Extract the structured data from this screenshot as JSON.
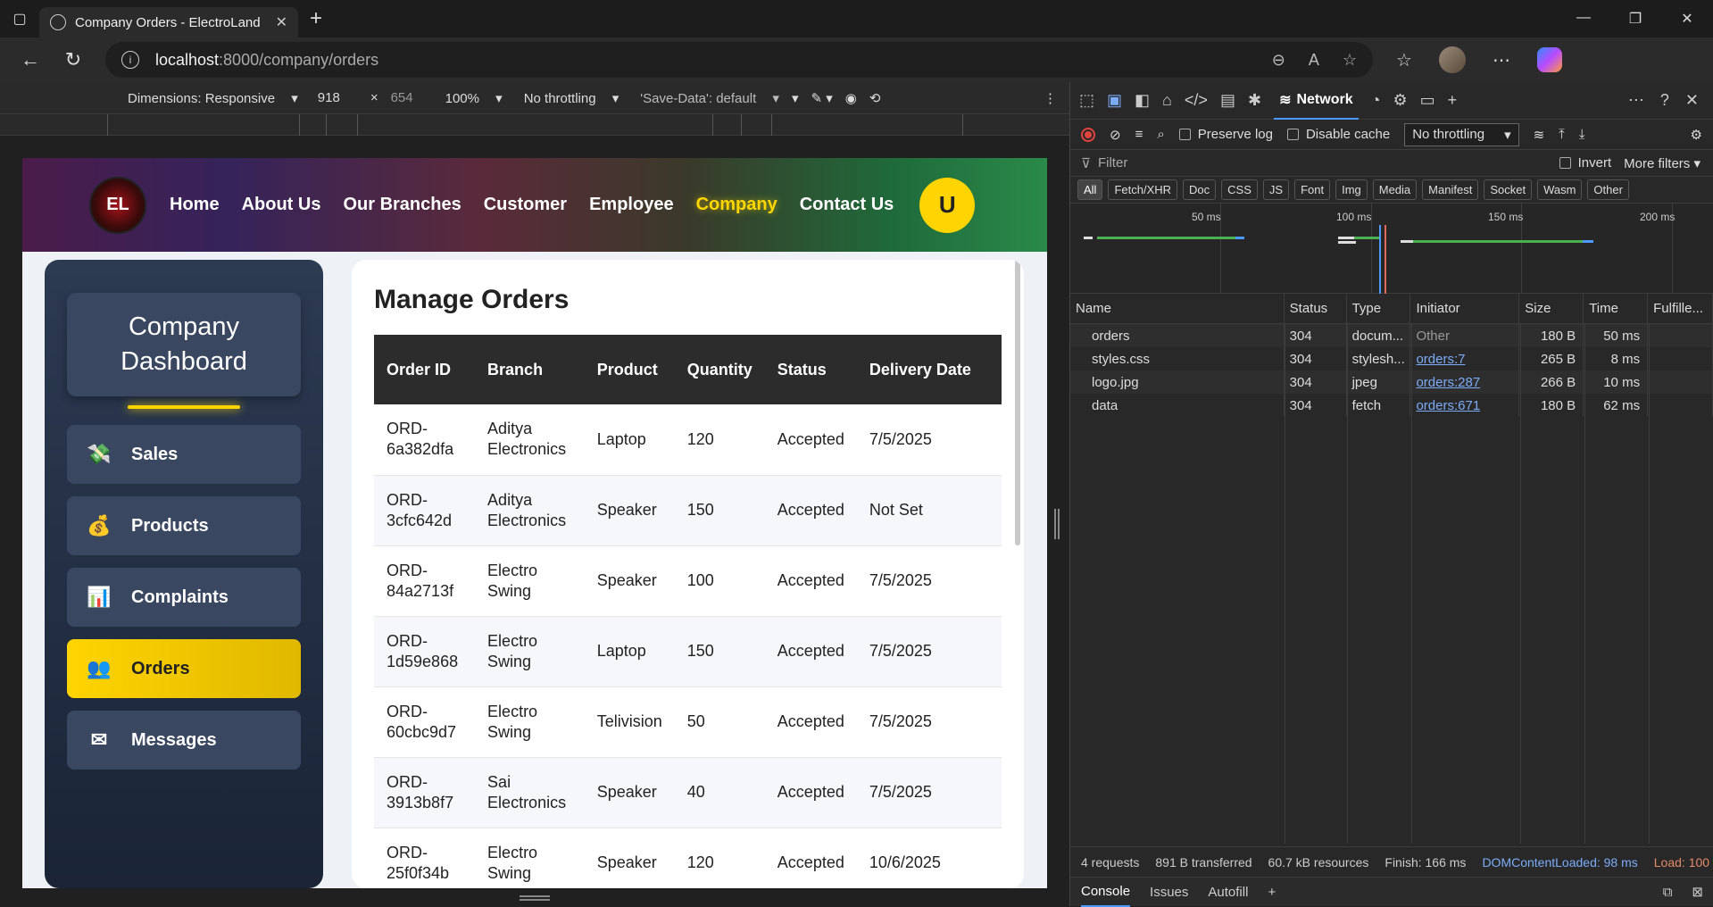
{
  "browser": {
    "tab_title": "Company Orders - ElectroLand",
    "url_host": "localhost",
    "url_path": ":8000/company/orders"
  },
  "device_toolbar": {
    "dimensions": "Dimensions: Responsive",
    "width": "918",
    "times": "×",
    "height": "654",
    "zoom": "100%",
    "throttling": "No throttling",
    "save_data": "'Save-Data': default"
  },
  "site": {
    "logo_text": "EL",
    "nav": [
      "Home",
      "About Us",
      "Our Branches",
      "Customer",
      "Employee",
      "Company",
      "Contact Us"
    ],
    "active_nav": "Company",
    "user_initial": "U"
  },
  "sidebar": {
    "title_line1": "Company",
    "title_line2": "Dashboard",
    "items": [
      {
        "label": "Sales",
        "icon": "💸"
      },
      {
        "label": "Products",
        "icon": "💰"
      },
      {
        "label": "Complaints",
        "icon": "📊"
      },
      {
        "label": "Orders",
        "icon": "👥"
      },
      {
        "label": "Messages",
        "icon": "✉"
      }
    ],
    "active": "Orders"
  },
  "orders": {
    "title": "Manage Orders",
    "columns": [
      "Order ID",
      "Branch",
      "Product",
      "Quantity",
      "Status",
      "Delivery Date"
    ],
    "rows": [
      [
        "ORD-6a382dfa",
        "Aditya Electronics",
        "Laptop",
        "120",
        "Accepted",
        "7/5/2025"
      ],
      [
        "ORD-3cfc642d",
        "Aditya Electronics",
        "Speaker",
        "150",
        "Accepted",
        "Not Set"
      ],
      [
        "ORD-84a2713f",
        "Electro Swing",
        "Speaker",
        "100",
        "Accepted",
        "7/5/2025"
      ],
      [
        "ORD-1d59e868",
        "Electro Swing",
        "Laptop",
        "150",
        "Accepted",
        "7/5/2025"
      ],
      [
        "ORD-60cbc9d7",
        "Electro Swing",
        "Telivision",
        "50",
        "Accepted",
        "7/5/2025"
      ],
      [
        "ORD-3913b8f7",
        "Sai Electronics",
        "Speaker",
        "40",
        "Accepted",
        "7/5/2025"
      ],
      [
        "ORD-25f0f34b",
        "Electro Swing",
        "Speaker",
        "120",
        "Accepted",
        "10/6/2025"
      ]
    ]
  },
  "devtools": {
    "active_tab": "Network",
    "preserve_log": "Preserve log",
    "disable_cache": "Disable cache",
    "throttling": "No throttling",
    "filter_placeholder": "Filter",
    "invert": "Invert",
    "more_filters": "More filters",
    "type_filters": [
      "All",
      "Fetch/XHR",
      "Doc",
      "CSS",
      "JS",
      "Font",
      "Img",
      "Media",
      "Manifest",
      "Socket",
      "Wasm",
      "Other"
    ],
    "timeline_labels": [
      "50 ms",
      "100 ms",
      "150 ms",
      "200 ms"
    ],
    "columns": [
      "Name",
      "Status",
      "Type",
      "Initiator",
      "Size",
      "Time",
      "Fulfille..."
    ],
    "requests": [
      {
        "name": "orders",
        "status": "304",
        "type": "docum...",
        "initiator": "Other",
        "size": "180 B",
        "time": "50 ms"
      },
      {
        "name": "styles.css",
        "status": "304",
        "type": "stylesh...",
        "initiator": "orders:7",
        "size": "265 B",
        "time": "8 ms"
      },
      {
        "name": "logo.jpg",
        "status": "304",
        "type": "jpeg",
        "initiator": "orders:287",
        "size": "266 B",
        "time": "10 ms"
      },
      {
        "name": "data",
        "status": "304",
        "type": "fetch",
        "initiator": "orders:671",
        "size": "180 B",
        "time": "62 ms"
      }
    ],
    "summary": {
      "requests": "4 requests",
      "transferred": "891 B transferred",
      "resources": "60.7 kB resources",
      "finish": "Finish: 166 ms",
      "dcl": "DOMContentLoaded: 98 ms",
      "load": "Load: 100"
    },
    "drawer_tabs": [
      "Console",
      "Issues",
      "Autofill"
    ]
  }
}
